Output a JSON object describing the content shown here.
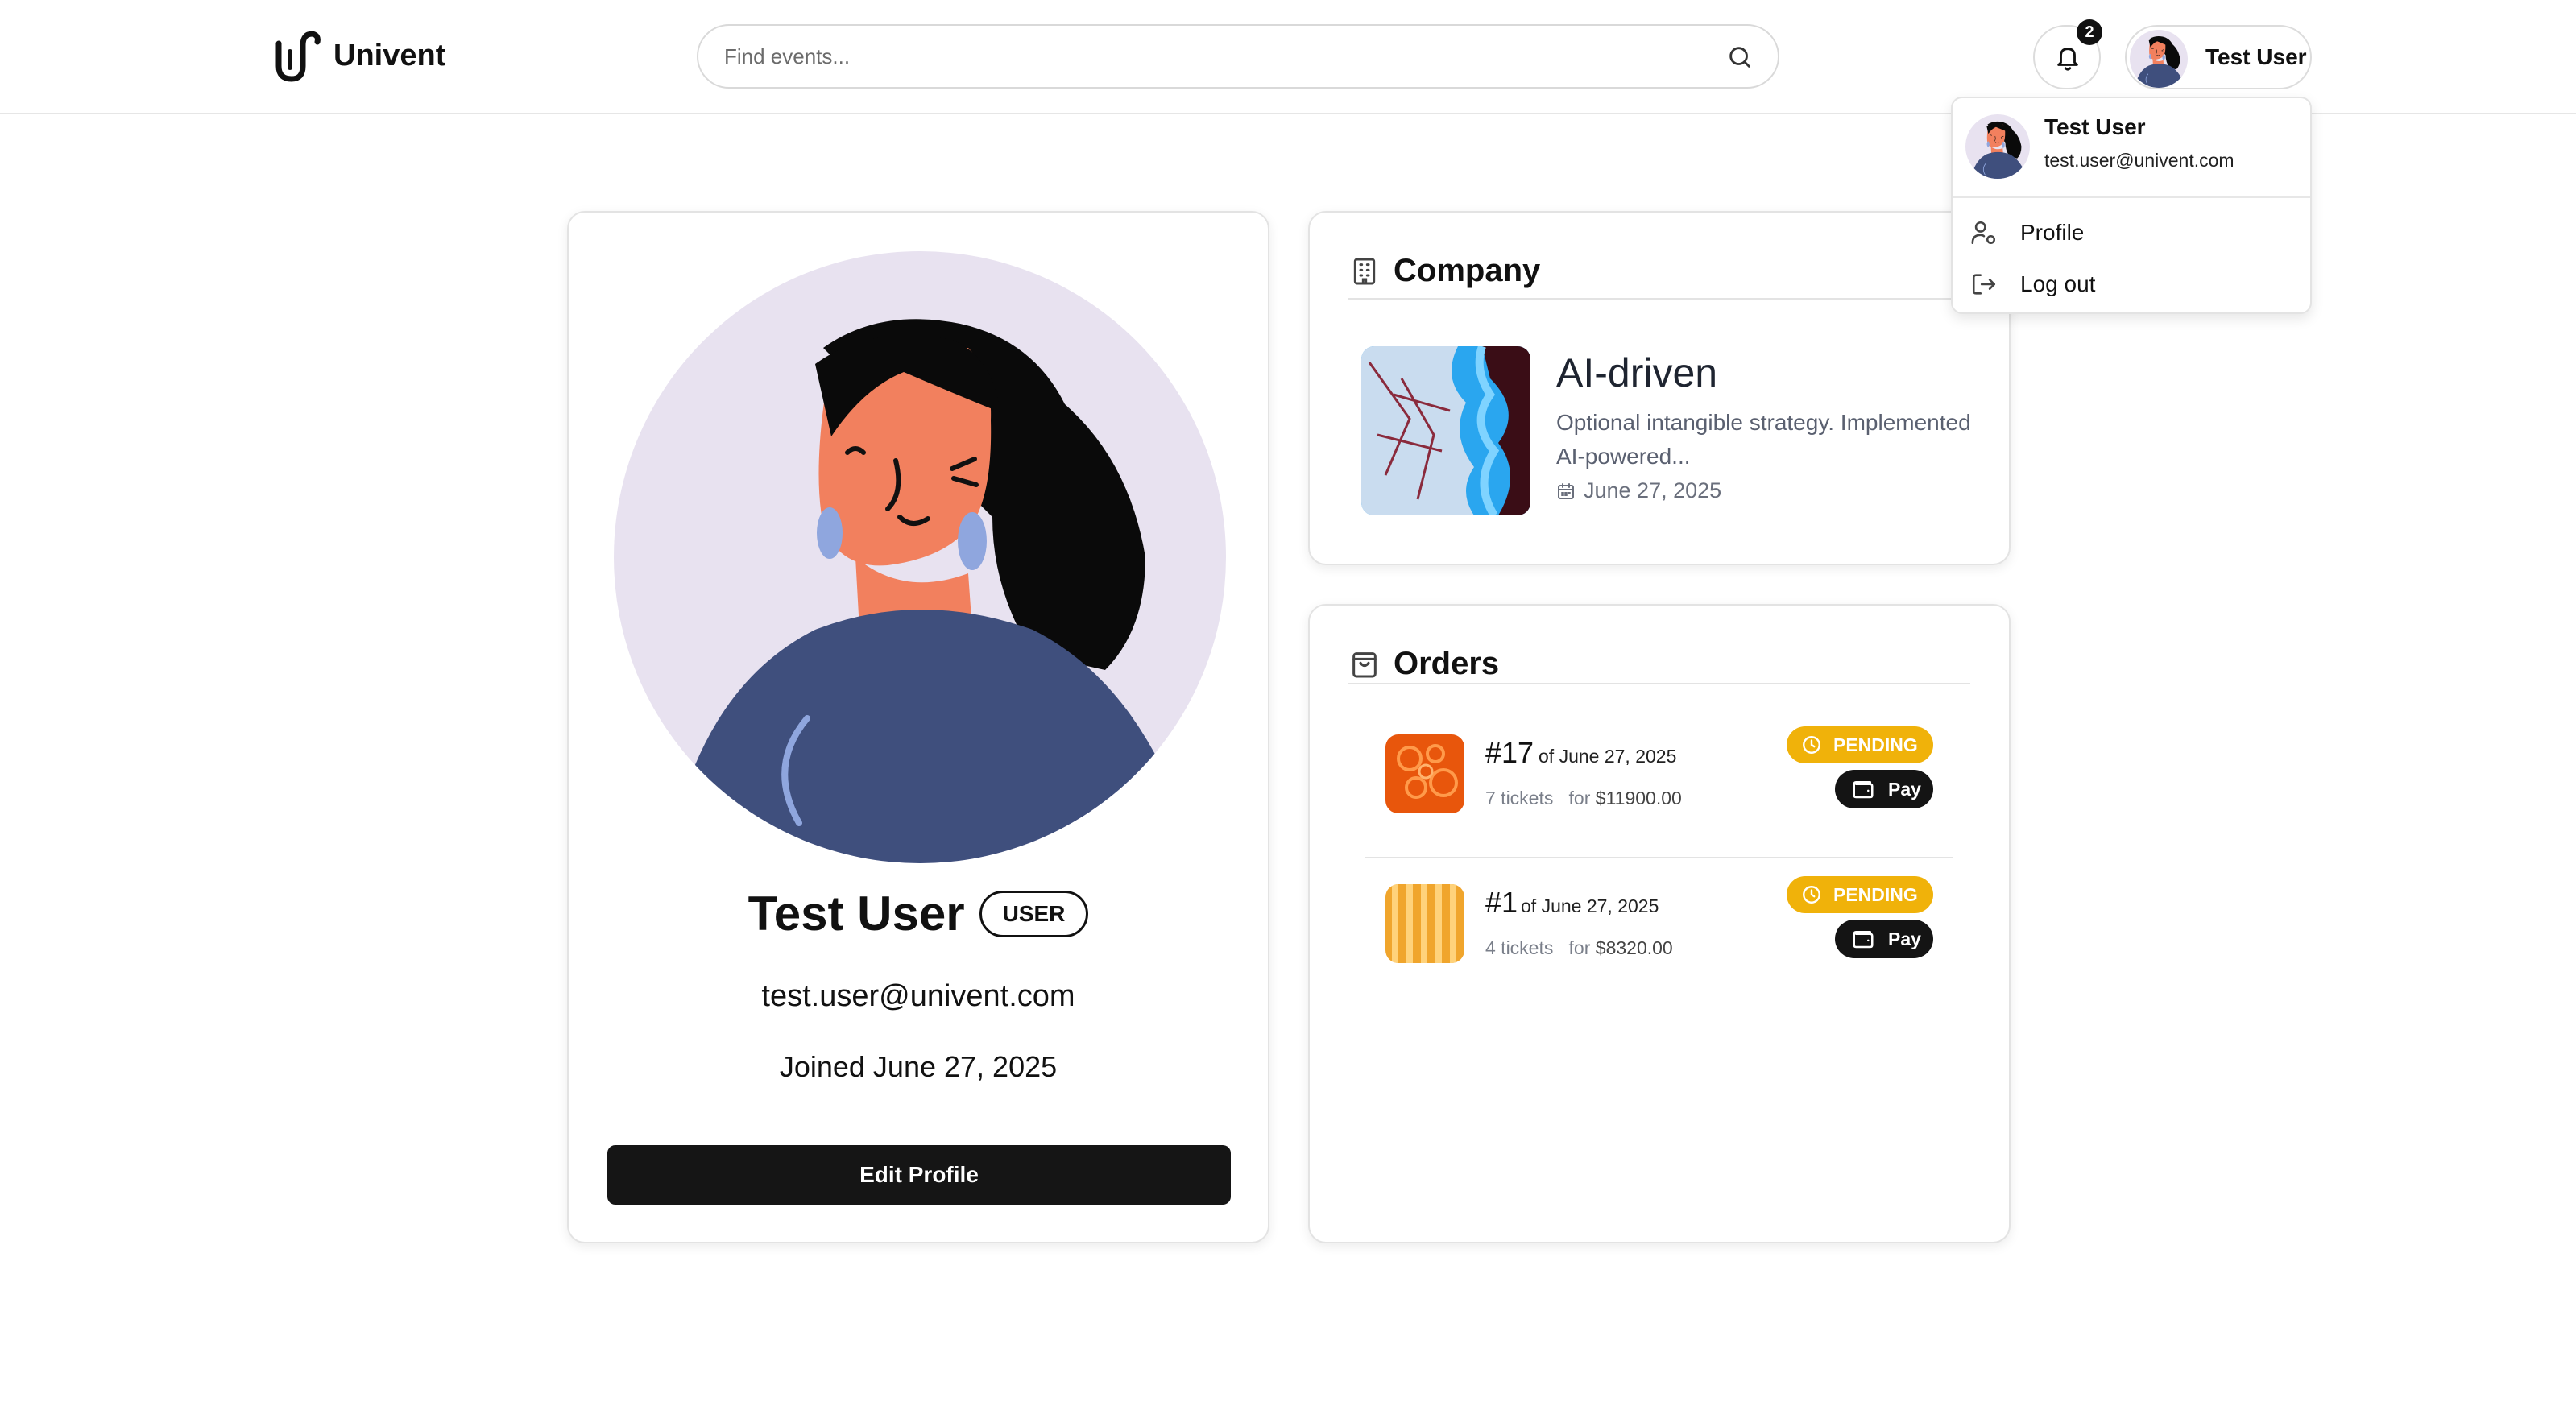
{
  "app": {
    "name": "Univent"
  },
  "header": {
    "search_placeholder": "Find events...",
    "notifications_count": "2",
    "user_name": "Test User"
  },
  "dropdown": {
    "name": "Test User",
    "email": "test.user@univent.com",
    "items": [
      {
        "label": "Profile",
        "icon": "user-cog-icon"
      },
      {
        "label": "Log out",
        "icon": "log-out-icon"
      }
    ]
  },
  "profile": {
    "name": "Test User",
    "role": "USER",
    "email": "test.user@univent.com",
    "joined": "Joined June 27, 2025",
    "edit_label": "Edit Profile"
  },
  "company": {
    "heading": "Company",
    "title": "AI-driven",
    "description": "Optional intangible strategy. Implemented AI-powered...",
    "date": "June 27, 2025"
  },
  "orders": {
    "heading": "Orders",
    "items": [
      {
        "number": "#17",
        "date": "of June 27, 2025",
        "tickets": "7 tickets",
        "amount_prefix": "for",
        "amount": "$11900.00",
        "status": "PENDING",
        "action": "Pay"
      },
      {
        "number": "#1",
        "date": "of June 27, 2025",
        "tickets": "4 tickets",
        "amount_prefix": "for",
        "amount": "$8320.00",
        "status": "PENDING",
        "action": "Pay"
      }
    ]
  },
  "colors": {
    "accent_dark": "#151515",
    "pending": "#f0b20a",
    "avatar_bg": "#e8e2f0",
    "shirt": "#3f4f7d",
    "skin": "#f2805e"
  }
}
